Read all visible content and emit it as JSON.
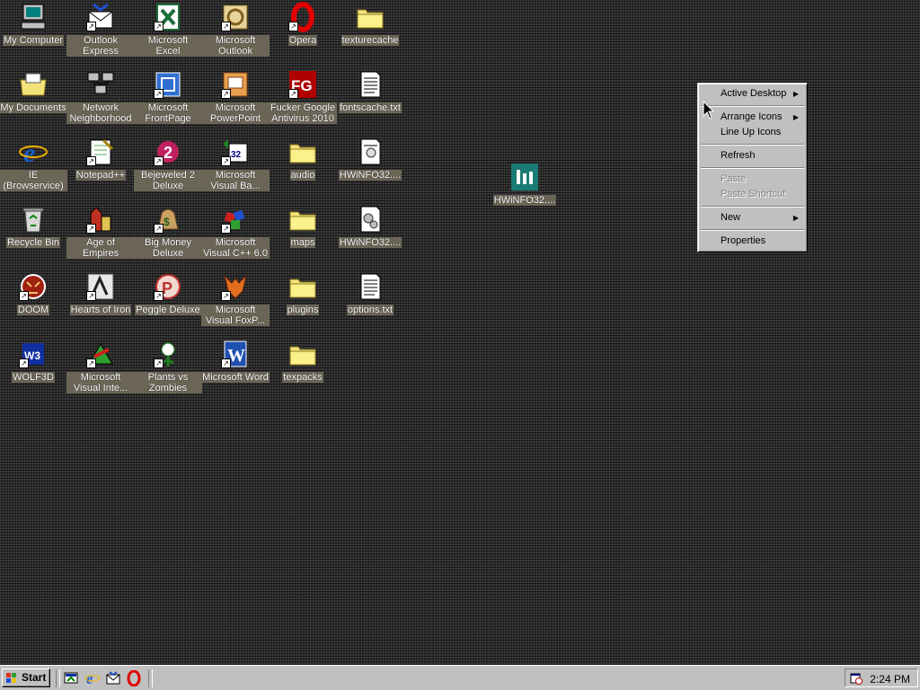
{
  "desktop": {
    "icons": [
      {
        "label": "My Computer",
        "icon": "my-computer-icon"
      },
      {
        "label": "Outlook Express",
        "icon": "outlook-express-icon"
      },
      {
        "label": "Microsoft Excel",
        "icon": "excel-icon"
      },
      {
        "label": "Microsoft Outlook",
        "icon": "outlook-icon"
      },
      {
        "label": "Opera",
        "icon": "opera-icon"
      },
      {
        "label": "texturecache",
        "icon": "folder-icon"
      },
      {
        "label": "My Documents",
        "icon": "my-documents-icon"
      },
      {
        "label": "Network Neighborhood",
        "icon": "network-icon"
      },
      {
        "label": "Microsoft FrontPage",
        "icon": "frontpage-icon"
      },
      {
        "label": "Microsoft PowerPoint",
        "icon": "powerpoint-icon"
      },
      {
        "label": "Fucker Google Antivirus 2010",
        "icon": "fg-icon"
      },
      {
        "label": "fontscache.txt",
        "icon": "text-file-icon"
      },
      {
        "label": "IE (Browservice)",
        "icon": "ie-icon"
      },
      {
        "label": "Notepad++",
        "icon": "notepad-icon"
      },
      {
        "label": "Bejeweled 2 Deluxe",
        "icon": "bejeweled-icon"
      },
      {
        "label": "Microsoft Visual Ba...",
        "icon": "visual-basic-icon"
      },
      {
        "label": "audio",
        "icon": "folder-icon"
      },
      {
        "label": "HWiNFO32....",
        "icon": "hwinfo-doc-icon"
      },
      {
        "label": "Recycle Bin",
        "icon": "recycle-bin-icon"
      },
      {
        "label": "Age of Empires",
        "icon": "age-of-empires-icon"
      },
      {
        "label": "Big Money Deluxe",
        "icon": "big-money-icon"
      },
      {
        "label": "Microsoft Visual C++ 6.0",
        "icon": "visual-cpp-icon"
      },
      {
        "label": "maps",
        "icon": "folder-icon"
      },
      {
        "label": "HWiNFO32....",
        "icon": "hwinfo-config-icon"
      },
      {
        "label": "DOOM",
        "icon": "doom-icon"
      },
      {
        "label": "Hearts of Iron",
        "icon": "hearts-of-iron-icon"
      },
      {
        "label": "Peggle Deluxe",
        "icon": "peggle-icon"
      },
      {
        "label": "Microsoft Visual FoxP...",
        "icon": "foxpro-icon"
      },
      {
        "label": "plugins",
        "icon": "folder-icon"
      },
      {
        "label": "options.txt",
        "icon": "text-file-icon"
      },
      {
        "label": "WOLF3D",
        "icon": "wolf3d-icon"
      },
      {
        "label": "Microsoft Visual Inte...",
        "icon": "visual-interdev-icon"
      },
      {
        "label": "Plants vs Zombies",
        "icon": "pvz-icon"
      },
      {
        "label": "Microsoft Word",
        "icon": "word-icon"
      },
      {
        "label": "texpacks",
        "icon": "folder-icon"
      },
      {
        "label": "HWiNFO32....",
        "icon": "hwinfo-app-icon"
      }
    ]
  },
  "context_menu": {
    "active_desktop": "Active Desktop",
    "arrange_icons": "Arrange Icons",
    "line_up_icons": "Line Up Icons",
    "refresh": "Refresh",
    "paste": "Paste",
    "paste_shortcut": "Paste Shortcut",
    "new": "New",
    "properties": "Properties"
  },
  "taskbar": {
    "start_label": "Start",
    "clock": "2:24 PM",
    "quick_launch": [
      "show-desktop-icon",
      "ie-icon",
      "outlook-express-icon",
      "opera-icon"
    ]
  },
  "colors": {
    "label_bg": "#6b6556",
    "face": "#c0c0c0"
  }
}
